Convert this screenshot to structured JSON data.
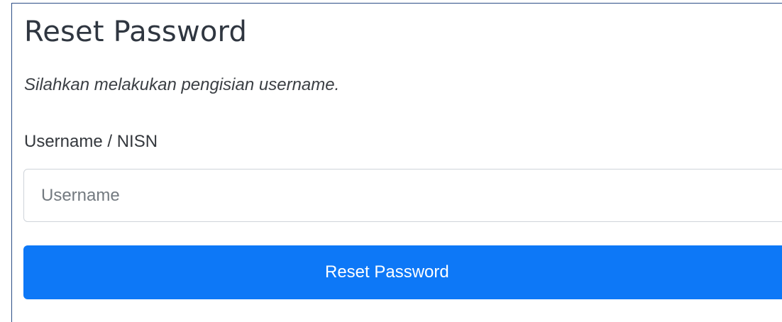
{
  "page": {
    "title": "Reset Password",
    "subtitle": "Silahkan melakukan pengisian username."
  },
  "form": {
    "username_label": "Username / NISN",
    "username_placeholder": "Username",
    "username_value": "",
    "submit_label": "Reset Password"
  },
  "colors": {
    "frame_border": "#2b4d86",
    "button_bg": "#0d78f7",
    "button_text": "#ffffff",
    "input_border": "#cfd4da"
  }
}
